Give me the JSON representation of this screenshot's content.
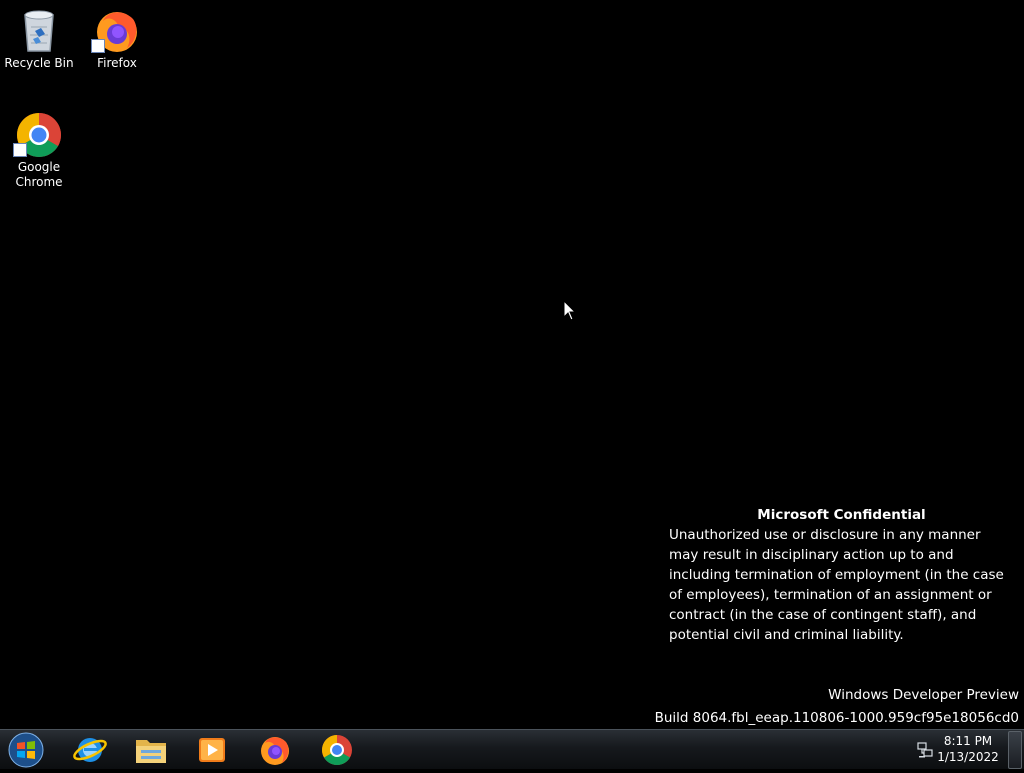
{
  "desktop": {
    "icons": [
      {
        "label": "Recycle Bin",
        "icon": "recycle-bin-icon"
      },
      {
        "label": "Firefox",
        "icon": "firefox-icon"
      },
      {
        "label": "Google Chrome",
        "icon": "chrome-icon"
      }
    ]
  },
  "notice": {
    "title": "Microsoft Confidential",
    "body": "Unauthorized use or disclosure in any manner may result in disciplinary action up to and including termination of employment (in the case of employees), termination of an assignment or contract (in the case of contingent staff), and potential civil and criminal liability."
  },
  "build": {
    "edition": "Windows Developer Preview",
    "version": "Build 8064.fbl_eeap.110806-1000.959cf95e18056cd0"
  },
  "taskbar": {
    "start": {
      "icon": "windows-start-icon"
    },
    "pinned": [
      {
        "icon": "internet-explorer-icon"
      },
      {
        "icon": "file-explorer-icon"
      },
      {
        "icon": "media-player-icon"
      },
      {
        "icon": "firefox-icon"
      },
      {
        "icon": "chrome-icon"
      }
    ],
    "tray": {
      "network_icon": "network-icon",
      "time": "8:11 PM",
      "date": "1/13/2022"
    }
  },
  "colors": {
    "desktop_background": "#000000",
    "taskbar": "#16191d",
    "text": "#ffffff"
  }
}
